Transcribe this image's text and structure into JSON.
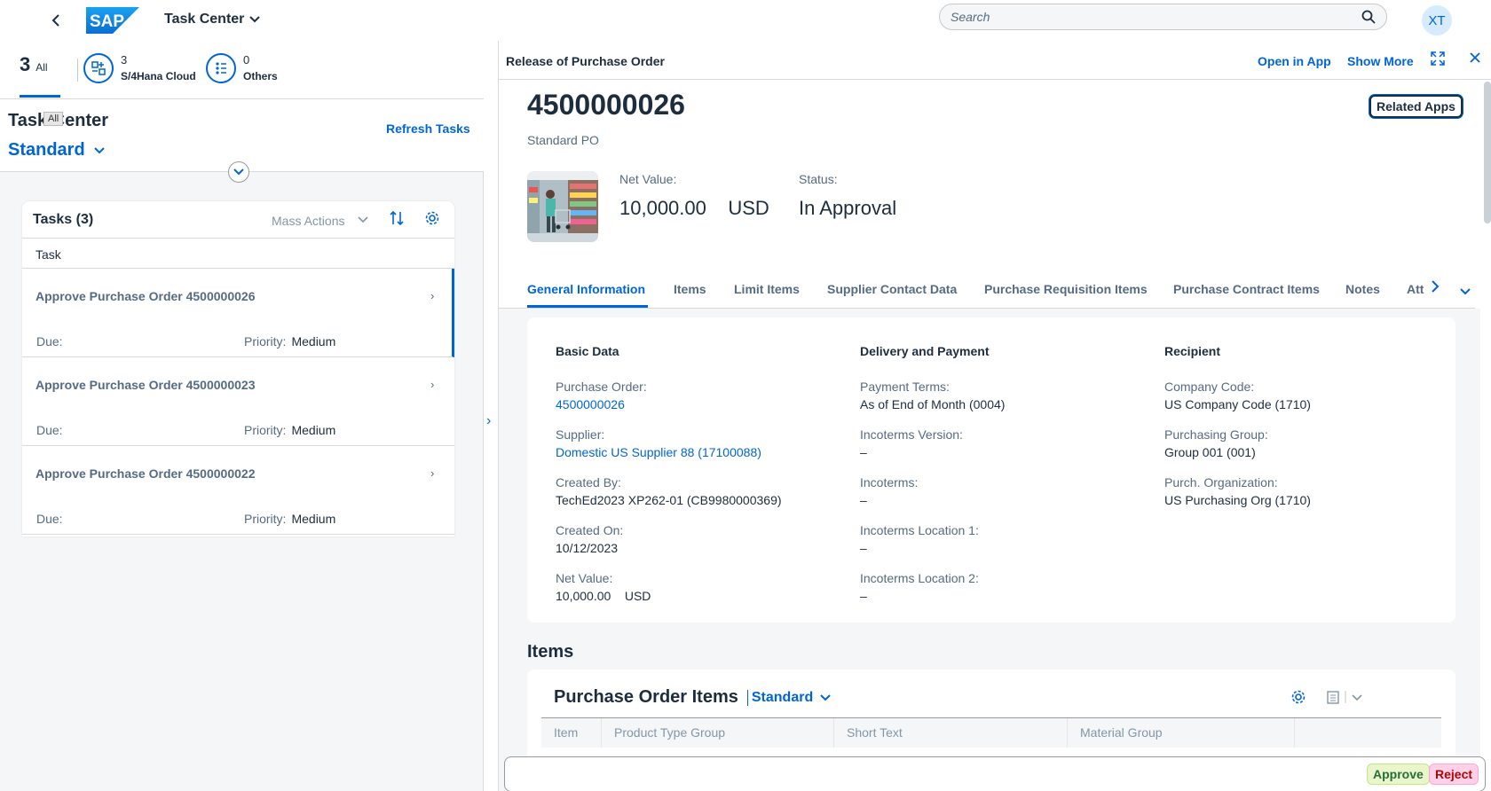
{
  "shell": {
    "title": "Task Center",
    "search_placeholder": "Search",
    "avatar": "XT",
    "logo": "SAP"
  },
  "filter_tabs": {
    "all": {
      "count": "3",
      "label": "All"
    },
    "s4": {
      "count": "3",
      "label": "S/4Hana Cloud"
    },
    "others": {
      "count": "0",
      "label": "Others"
    }
  },
  "left": {
    "title": "Task Center",
    "tooltip": "All",
    "variant": "Standard",
    "refresh": "Refresh Tasks",
    "tasks_title": "Tasks (3)",
    "mass_actions": "Mass Actions",
    "column_task": "Task",
    "due_label": "Due:",
    "priority_label": "Priority:",
    "rows": [
      {
        "name": "Approve Purchase Order 4500000026",
        "priority": "Medium"
      },
      {
        "name": "Approve Purchase Order 4500000023",
        "priority": "Medium"
      },
      {
        "name": "Approve Purchase Order 4500000022",
        "priority": "Medium"
      }
    ]
  },
  "right": {
    "header_title": "Release of Purchase Order",
    "open_in_app": "Open in App",
    "show_more": "Show More",
    "object_title": "4500000026",
    "object_subtitle": "Standard PO",
    "related_apps": "Related Apps",
    "net_value_label": "Net Value:",
    "net_value": "10,000.00",
    "net_value_currency": "USD",
    "status_label": "Status:",
    "status": "In Approval",
    "tabs": [
      "General Information",
      "Items",
      "Limit Items",
      "Supplier Contact Data",
      "Purchase Requisition Items",
      "Purchase Contract Items",
      "Notes",
      "Att"
    ],
    "basic_data": {
      "heading": "Basic Data",
      "fields": [
        {
          "label": "Purchase Order:",
          "value": "4500000026"
        },
        {
          "label": "Supplier:",
          "value": "Domestic US Supplier 88 (17100088)"
        },
        {
          "label": "Created By:",
          "value": "TechEd2023 XP262-01 (CB9980000369)"
        },
        {
          "label": "Created On:",
          "value": "10/12/2023"
        },
        {
          "label": "Net Value:",
          "value": "10,000.00    USD"
        }
      ]
    },
    "delivery": {
      "heading": "Delivery and Payment",
      "fields": [
        {
          "label": "Payment Terms:",
          "value": "As of End of Month (0004)"
        },
        {
          "label": "Incoterms Version:",
          "value": "–"
        },
        {
          "label": "Incoterms:",
          "value": "–"
        },
        {
          "label": "Incoterms Location 1:",
          "value": "–"
        },
        {
          "label": "Incoterms Location 2:",
          "value": "–"
        }
      ]
    },
    "recipient": {
      "heading": "Recipient",
      "fields": [
        {
          "label": "Company Code:",
          "value": "US Company Code (1710)"
        },
        {
          "label": "Purchasing Group:",
          "value": "Group 001 (001)"
        },
        {
          "label": "Purch. Organization:",
          "value": "US Purchasing Org (1710)"
        }
      ]
    },
    "items_title": "Items",
    "table_title": "Purchase Order Items",
    "table_variant": "Standard",
    "table_columns": [
      "Item",
      "Product Type Group",
      "Short Text",
      "Material Group",
      ""
    ],
    "approve": "Approve",
    "reject": "Reject"
  }
}
